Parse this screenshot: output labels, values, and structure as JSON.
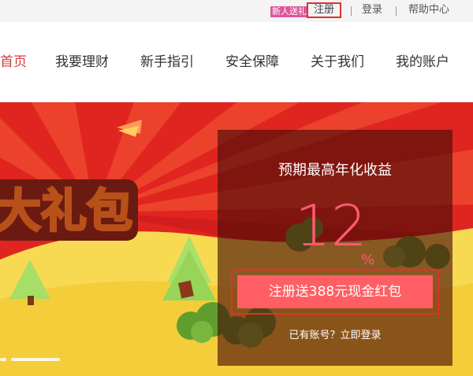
{
  "topbar": {
    "promo_label": "新人送礼",
    "register_label": "注册",
    "login_label": "登录",
    "help_label": "帮助中心"
  },
  "nav": {
    "items": [
      {
        "label": "首页",
        "active": true
      },
      {
        "label": "我要理财"
      },
      {
        "label": "新手指引"
      },
      {
        "label": "安全保障"
      },
      {
        "label": "关于我们"
      },
      {
        "label": "我的账户"
      }
    ]
  },
  "banner": {
    "headline": "大礼包",
    "panel": {
      "title": "预期最高年化收益",
      "rate_value": "12",
      "rate_unit": "%",
      "cta_label": "注册送388元现金红包",
      "login_prompt": "已有账号？立即登录"
    },
    "slide_indicators": 2
  },
  "colors": {
    "accent_red": "#e32622",
    "rate_pink": "#ff5a72",
    "cta_bg": "#ff5f64",
    "highlight_border": "#e0302d"
  }
}
